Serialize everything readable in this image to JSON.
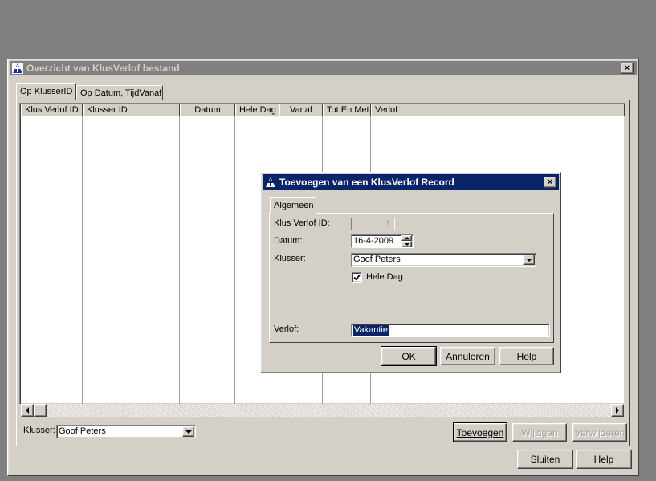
{
  "main_window": {
    "title": "Overzicht van KlusVerlof bestand",
    "close_label": "×",
    "tabs": [
      {
        "label": "Op KlusserID",
        "active": true
      },
      {
        "label": "Op Datum, TijdVanaf",
        "active": false
      }
    ],
    "columns": [
      "Klus Verlof ID",
      "Klusser ID",
      "Datum",
      "Hele Dag",
      "Vanaf",
      "Tot En Met",
      "Verlof"
    ],
    "filter_label": "Klusser:",
    "filter_value": "Goof Peters",
    "buttons": {
      "add": "Toevoegen",
      "edit": "Wijzigen",
      "delete": "Verwijderen",
      "close": "Sluiten",
      "help": "Help"
    }
  },
  "dialog": {
    "title": "Toevoegen van een KlusVerlof Record",
    "close_label": "×",
    "tab": "Algemeen",
    "fields": {
      "id_label": "Klus Verlof ID:",
      "id_value": "1",
      "date_label": "Datum:",
      "date_value": "16-4-2009",
      "klusser_label": "Klusser:",
      "klusser_value": "Goof Peters",
      "hele_dag_label": "Hele Dag",
      "hele_dag_checked": true,
      "verlof_label": "Verlof:",
      "verlof_value": "Vakantie"
    },
    "buttons": {
      "ok": "OK",
      "cancel": "Annuleren",
      "help": "Help"
    }
  },
  "colors": {
    "desktop": "#808080",
    "face": "#d4d0c8",
    "title_active": "#0a246a",
    "title_inactive": "#808080",
    "selection": "#0a246a"
  },
  "icons": {
    "app": "app-logo-icon",
    "check": "check-icon",
    "combo": "chevron-down-icon",
    "spin_up": "spin-up-icon",
    "spin_down": "spin-down-icon",
    "scroll_left": "arrow-left-icon",
    "scroll_right": "arrow-right-icon",
    "close": "close-icon"
  }
}
